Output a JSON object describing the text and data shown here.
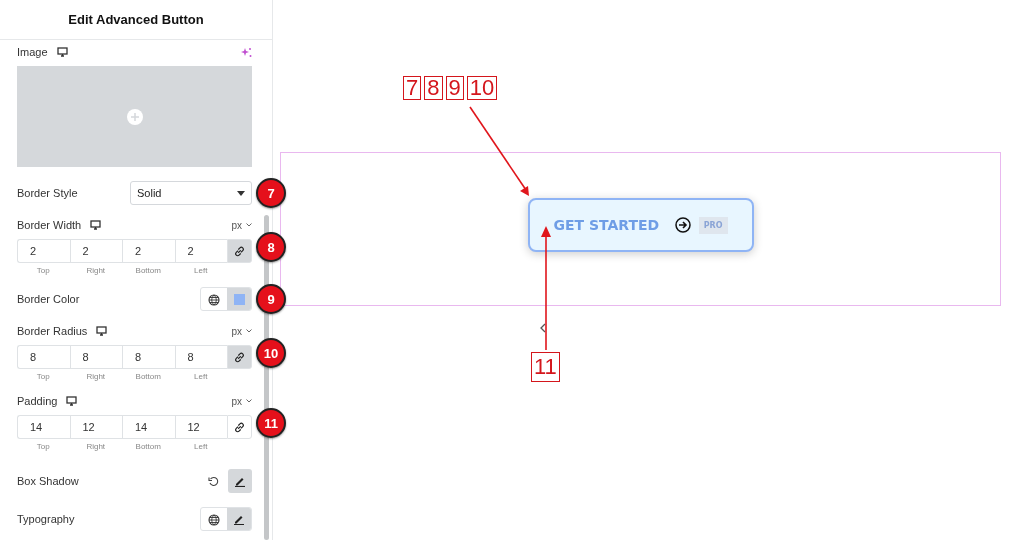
{
  "panel": {
    "title": "Edit Advanced Button",
    "image": {
      "label": "Image"
    },
    "border_style": {
      "label": "Border Style",
      "value": "Solid",
      "callout": "7"
    },
    "border_width": {
      "label": "Border Width",
      "unit": "px",
      "callout": "8",
      "linked": true,
      "fields": [
        {
          "value": "2",
          "label": "Top"
        },
        {
          "value": "2",
          "label": "Right"
        },
        {
          "value": "2",
          "label": "Bottom"
        },
        {
          "value": "2",
          "label": "Left"
        }
      ]
    },
    "border_color": {
      "label": "Border Color",
      "color": "#8fb4f5",
      "callout": "9"
    },
    "border_radius": {
      "label": "Border Radius",
      "unit": "px",
      "callout": "10",
      "linked": true,
      "fields": [
        {
          "value": "8",
          "label": "Top"
        },
        {
          "value": "8",
          "label": "Right"
        },
        {
          "value": "8",
          "label": "Bottom"
        },
        {
          "value": "8",
          "label": "Left"
        }
      ]
    },
    "padding": {
      "label": "Padding",
      "unit": "px",
      "callout": "11",
      "linked": false,
      "fields": [
        {
          "value": "14",
          "label": "Top"
        },
        {
          "value": "12",
          "label": "Right"
        },
        {
          "value": "14",
          "label": "Bottom"
        },
        {
          "value": "12",
          "label": "Left"
        }
      ]
    },
    "box_shadow": {
      "label": "Box Shadow"
    },
    "typography": {
      "label": "Typography"
    }
  },
  "canvas": {
    "button": {
      "text": "GET STARTED",
      "badge": "PRO"
    },
    "top_labels": [
      "7",
      "8",
      "9",
      "10"
    ],
    "bottom_label": "11"
  }
}
